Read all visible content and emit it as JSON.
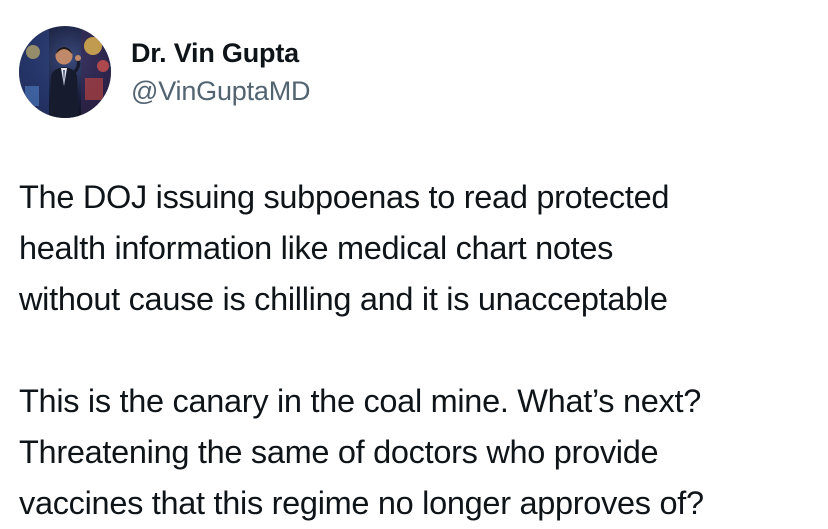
{
  "author": {
    "display_name": "Dr. Vin Gupta",
    "handle": "@VinGuptaMD",
    "avatar_icon": "profile-photo",
    "colors": {
      "name": "#0f1419",
      "handle": "#536471"
    }
  },
  "tweet": {
    "paragraphs": [
      {
        "lines": [
          "The DOJ issuing subpoenas to read protected",
          "health information like medical chart notes",
          "without cause is chilling and it is unacceptable"
        ]
      },
      {
        "lines": [
          "This is the canary in the coal mine. What’s next?",
          "Threatening the same of doctors who provide",
          "vaccines that this regime no longer approves of?"
        ]
      }
    ],
    "colors": {
      "text": "#0f1419",
      "background": "#ffffff"
    }
  }
}
